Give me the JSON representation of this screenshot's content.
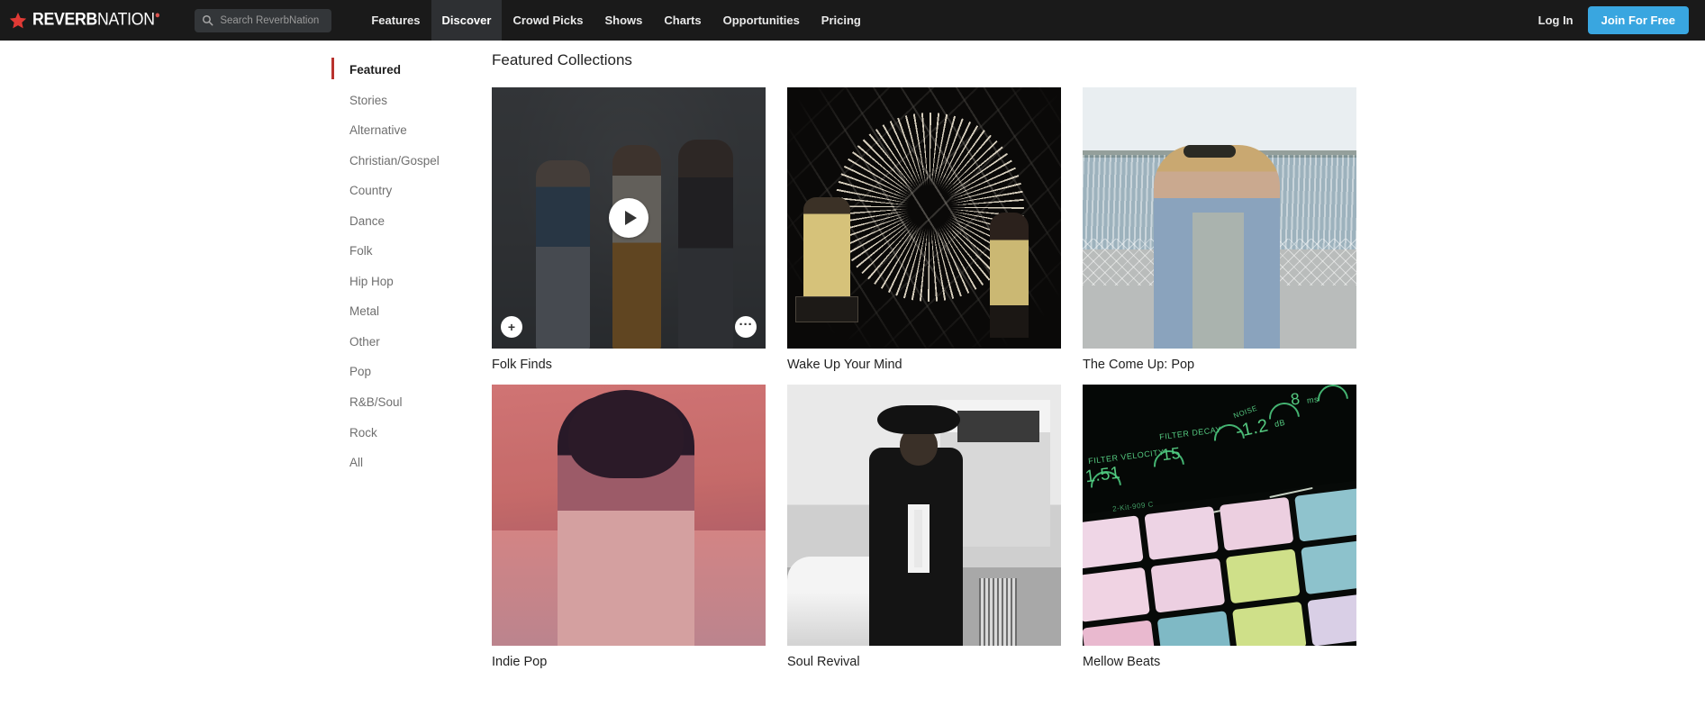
{
  "header": {
    "logo_text_bold": "REVERB",
    "logo_text_thin": "NATION",
    "logo_star_icon": "star-icon",
    "search": {
      "placeholder": "Search ReverbNation",
      "value": "",
      "icon": "search-icon"
    },
    "nav": [
      {
        "label": "Features",
        "active": false
      },
      {
        "label": "Discover",
        "active": true
      },
      {
        "label": "Crowd Picks",
        "active": false
      },
      {
        "label": "Shows",
        "active": false
      },
      {
        "label": "Charts",
        "active": false
      },
      {
        "label": "Opportunities",
        "active": false
      },
      {
        "label": "Pricing",
        "active": false
      }
    ],
    "login_label": "Log In",
    "join_label": "Join For Free",
    "colors": {
      "bar_background": "#1a1a1a",
      "active_tab_background": "#2e3033",
      "join_button": "#39a6e0",
      "search_background": "#333639",
      "logo_star": "#e03a35"
    }
  },
  "sidebar": {
    "active_indicator_color": "#b9332e",
    "items": [
      {
        "label": "Featured",
        "active": true
      },
      {
        "label": "Stories",
        "active": false
      },
      {
        "label": "Alternative",
        "active": false
      },
      {
        "label": "Christian/Gospel",
        "active": false
      },
      {
        "label": "Country",
        "active": false
      },
      {
        "label": "Dance",
        "active": false
      },
      {
        "label": "Folk",
        "active": false
      },
      {
        "label": "Hip Hop",
        "active": false
      },
      {
        "label": "Metal",
        "active": false
      },
      {
        "label": "Other",
        "active": false
      },
      {
        "label": "Pop",
        "active": false
      },
      {
        "label": "R&B/Soul",
        "active": false
      },
      {
        "label": "Rock",
        "active": false
      },
      {
        "label": "All",
        "active": false
      }
    ]
  },
  "main": {
    "title": "Featured Collections",
    "card_overlay": {
      "play_icon": "play-icon",
      "add_icon": "plus-icon",
      "more_icon": "ellipsis-icon",
      "more_glyph": "···",
      "add_glyph": "+"
    },
    "collections": [
      {
        "title": "Folk Finds",
        "art": "folk",
        "hovered": true
      },
      {
        "title": "Wake Up Your Mind",
        "art": "spark",
        "hovered": false
      },
      {
        "title": "The Come Up: Pop",
        "art": "denim",
        "hovered": false
      },
      {
        "title": "Indie Pop",
        "art": "pink",
        "hovered": false
      },
      {
        "title": "Soul Revival",
        "art": "bw",
        "hovered": false
      },
      {
        "title": "Mellow Beats",
        "art": "pads",
        "hovered": false
      }
    ]
  },
  "pads_artwork": {
    "led_labels": [
      "FILTER VELOCITY",
      "FILTER DECAY",
      "NOISE",
      "1.51",
      "15",
      "-1.2",
      "dB",
      "8",
      "ms",
      "2-Kit-909 C"
    ]
  }
}
